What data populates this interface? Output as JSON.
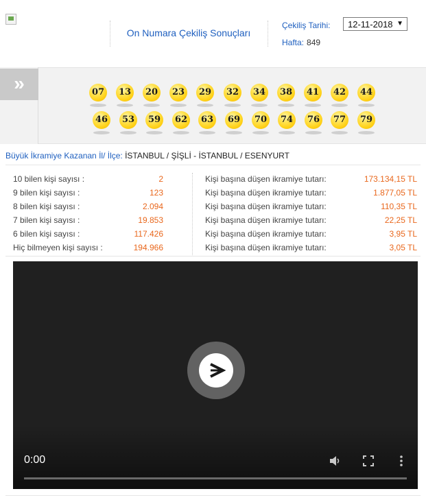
{
  "header": {
    "title": "On Numara Çekiliş Sonuçları",
    "draw_date_label": "Çekiliş Tarihi:",
    "selected_date": "12-11-2018",
    "week_label": "Hafta:",
    "week_value": "849"
  },
  "numbers": {
    "row1": [
      "07",
      "13",
      "20",
      "23",
      "29",
      "32",
      "34",
      "38",
      "41",
      "42",
      "44"
    ],
    "row2": [
      "46",
      "53",
      "59",
      "62",
      "63",
      "69",
      "70",
      "74",
      "76",
      "77",
      "79"
    ]
  },
  "winner": {
    "label": "Büyük İkramiye Kazanan İl/ İlçe:",
    "value": "İSTANBUL / ŞİŞLİ - İSTANBUL / ESENYURT"
  },
  "stats": [
    {
      "label": "10 bilen kişi sayısı :",
      "count": "2",
      "prize_label": "Kişi başına düşen ikramiye tutarı:",
      "prize": "173.134,15 TL"
    },
    {
      "label": "9 bilen kişi sayısı :",
      "count": "123",
      "prize_label": "Kişi başına düşen ikramiye tutarı:",
      "prize": "1.877,05 TL"
    },
    {
      "label": "8 bilen kişi sayısı :",
      "count": "2.094",
      "prize_label": "Kişi başına düşen ikramiye tutarı:",
      "prize": "110,35 TL"
    },
    {
      "label": "7 bilen kişi sayısı :",
      "count": "19.853",
      "prize_label": "Kişi başına düşen ikramiye tutarı:",
      "prize": "22,25 TL"
    },
    {
      "label": "6 bilen kişi sayısı :",
      "count": "117.426",
      "prize_label": "Kişi başına düşen ikramiye tutarı:",
      "prize": "3,95 TL"
    },
    {
      "label": "Hiç bilmeyen kişi sayısı :",
      "count": "194.966",
      "prize_label": "Kişi başına düşen ikramiye tutarı:",
      "prize": "3,05 TL"
    }
  ],
  "video": {
    "time": "0:00",
    "progress": 0
  },
  "icons": {
    "expand": "double-chevron-right-icon",
    "play": "play-icon",
    "volume": "volume-icon",
    "fullscreen": "fullscreen-icon",
    "more": "more-vertical-icon"
  }
}
